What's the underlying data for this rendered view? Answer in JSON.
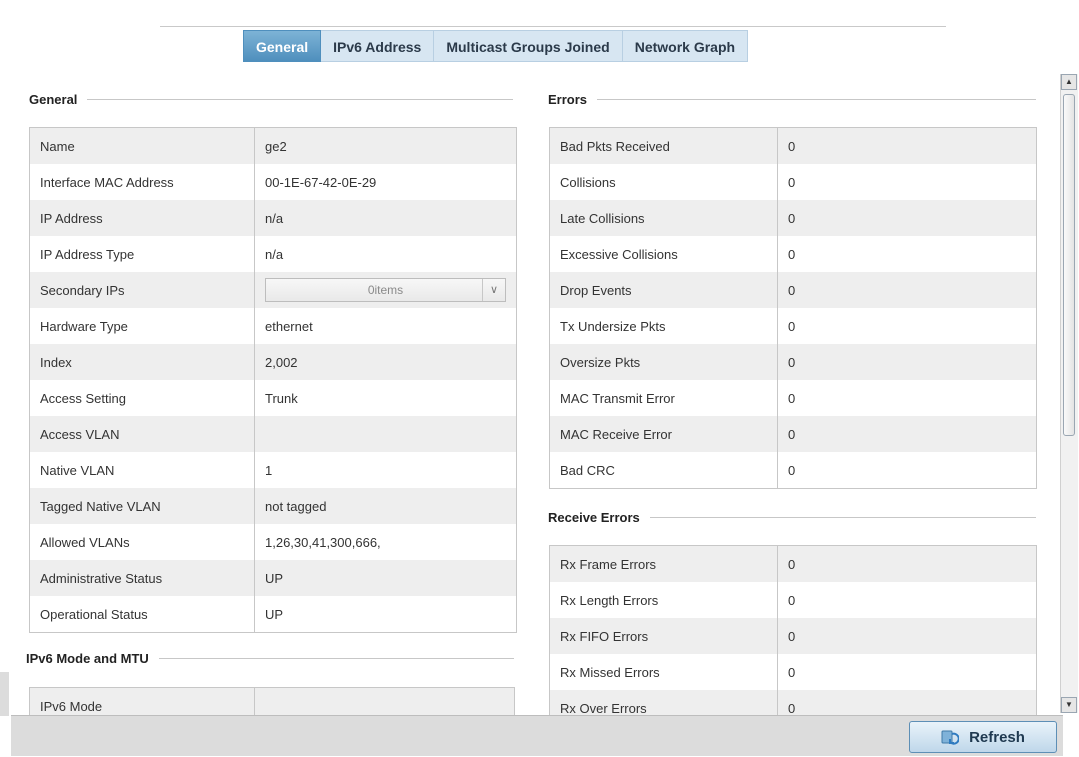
{
  "tabs": [
    {
      "label": "General",
      "active": true
    },
    {
      "label": "IPv6 Address",
      "active": false
    },
    {
      "label": "Multicast Groups Joined",
      "active": false
    },
    {
      "label": "Network Graph",
      "active": false
    }
  ],
  "general": {
    "title": "General",
    "rows": [
      {
        "key": "Name",
        "value": "ge2"
      },
      {
        "key": "Interface MAC Address",
        "value": "00-1E-67-42-0E-29"
      },
      {
        "key": "IP Address",
        "value": "n/a"
      },
      {
        "key": "IP Address Type",
        "value": "n/a"
      },
      {
        "key": "Secondary IPs",
        "value": "0items"
      },
      {
        "key": "Hardware Type",
        "value": "ethernet"
      },
      {
        "key": "Index",
        "value": "2,002"
      },
      {
        "key": "Access Setting",
        "value": "Trunk"
      },
      {
        "key": "Access VLAN",
        "value": ""
      },
      {
        "key": "Native VLAN",
        "value": "1"
      },
      {
        "key": "Tagged Native VLAN",
        "value": "not tagged"
      },
      {
        "key": "Allowed VLANs",
        "value": "1,26,30,41,300,666,"
      },
      {
        "key": "Administrative Status",
        "value": "UP"
      },
      {
        "key": "Operational Status",
        "value": "UP"
      }
    ]
  },
  "ipv6": {
    "title": "IPv6 Mode and MTU",
    "rows": [
      {
        "key": "IPv6 Mode",
        "value": ""
      }
    ]
  },
  "errors": {
    "title": "Errors",
    "rows": [
      {
        "key": "Bad Pkts Received",
        "value": "0"
      },
      {
        "key": "Collisions",
        "value": "0"
      },
      {
        "key": "Late Collisions",
        "value": "0"
      },
      {
        "key": "Excessive Collisions",
        "value": "0"
      },
      {
        "key": "Drop Events",
        "value": "0"
      },
      {
        "key": "Tx Undersize Pkts",
        "value": "0"
      },
      {
        "key": "Oversize Pkts",
        "value": "0"
      },
      {
        "key": "MAC Transmit Error",
        "value": "0"
      },
      {
        "key": "MAC Receive Error",
        "value": "0"
      },
      {
        "key": "Bad CRC",
        "value": "0"
      }
    ]
  },
  "receive_errors": {
    "title": "Receive Errors",
    "rows": [
      {
        "key": "Rx Frame Errors",
        "value": "0"
      },
      {
        "key": "Rx Length Errors",
        "value": "0"
      },
      {
        "key": "Rx FIFO Errors",
        "value": "0"
      },
      {
        "key": "Rx Missed Errors",
        "value": "0"
      },
      {
        "key": "Rx Over Errors",
        "value": "0"
      }
    ]
  },
  "footer": {
    "refresh_label": "Refresh",
    "refresh_icon": "refresh-icon"
  },
  "colors": {
    "tab_active": "#4f8fbd",
    "tab_inactive": "#d7e6f2",
    "row_alt": "#eeeeee",
    "border": "#c7c7c7"
  }
}
